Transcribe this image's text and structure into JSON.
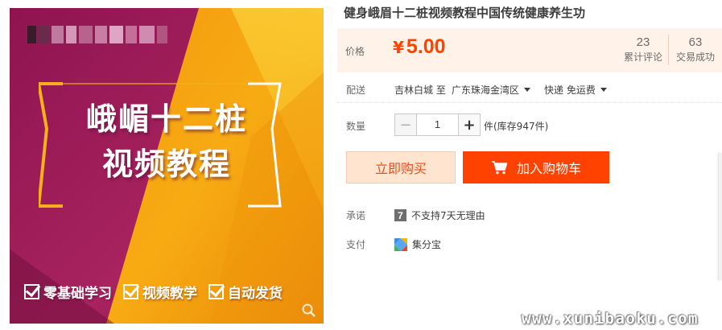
{
  "product": {
    "title": "健身峨眉十二桩视频教程中国传统健康养生功"
  },
  "cover": {
    "title_line1": "峨嵋十二桩",
    "title_line2": "视频教程",
    "features": [
      "零基础学习",
      "视频教学",
      "自动发货"
    ],
    "colors": {
      "magenta": "#9a1c5a",
      "orange": "#f4a20c",
      "yellow": "#fbc02d"
    }
  },
  "price": {
    "label": "价格",
    "currency": "¥",
    "value": "5.00",
    "reviews_count": "23",
    "reviews_label": "累计评论",
    "deals_count": "63",
    "deals_label": "交易成功"
  },
  "shipping": {
    "label": "配送",
    "from": "吉林白城 至",
    "to": "广东珠海金湾区",
    "method": "快递 免运费"
  },
  "quantity": {
    "label": "数量",
    "minus": "−",
    "value": "1",
    "plus": "+",
    "stock": "件(库存947件)"
  },
  "actions": {
    "buy_now": "立即购买",
    "add_to_cart": "加入购物车"
  },
  "promise": {
    "label": "承诺",
    "icon_text": "7",
    "text": "不支持7天无理由"
  },
  "payment": {
    "label": "支付",
    "method": "集分宝"
  },
  "watermark": "www.xunibaoku.com",
  "theme": {
    "accent": "#ff4200",
    "price_bg": "#fff2e8",
    "price_color": "#f40"
  }
}
